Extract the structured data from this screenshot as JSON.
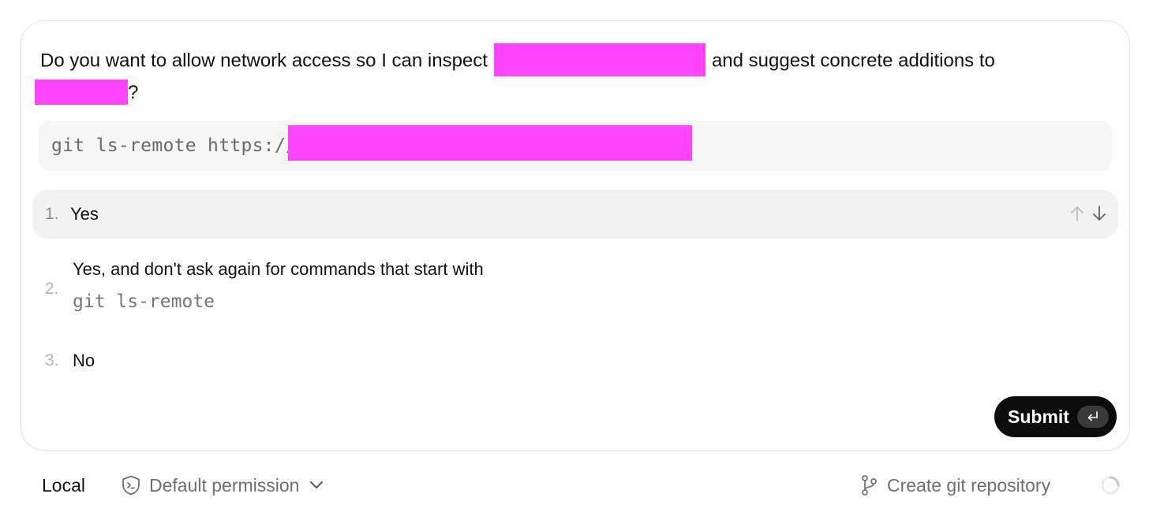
{
  "prompt": {
    "question_before": "Do you want to allow network access so I can inspect",
    "question_middle": "and suggest concrete additions to",
    "question_end": "?",
    "command_prefix": "git ls-remote https://"
  },
  "options": [
    {
      "number": "1.",
      "label": "Yes"
    },
    {
      "number": "2.",
      "label": "Yes, and don't ask again for commands that start with",
      "command": "git ls-remote"
    },
    {
      "number": "3.",
      "label": "No"
    }
  ],
  "submit": {
    "label": "Submit",
    "key_glyph": "⏎"
  },
  "footer": {
    "location": "Local",
    "permission": "Default permission",
    "git_action": "Create git repository"
  },
  "colors": {
    "redaction": "#ff44ff",
    "selected_bg": "#f2f2f2",
    "command_bg": "#f6f6f6",
    "submit_bg": "#0c0c0c"
  },
  "icons": {
    "nav_up": "arrow-up-icon",
    "nav_down": "arrow-down-icon",
    "enter": "return-key-icon",
    "permission": "shield-terminal-icon",
    "dropdown": "chevron-down-icon",
    "git": "git-branch-icon",
    "loading": "spinner-icon"
  }
}
